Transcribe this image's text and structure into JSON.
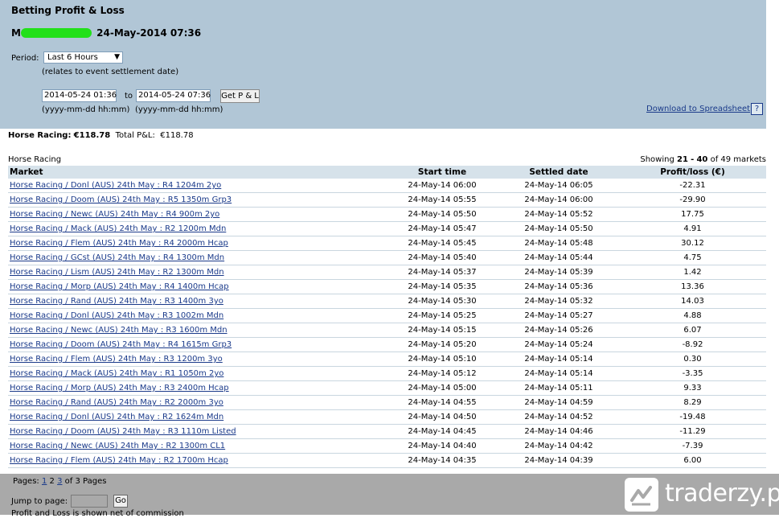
{
  "header": {
    "title": "Betting Profit & Loss",
    "account_initial": "M",
    "timestamp": "24-May-2014 07:36",
    "period_label": "Period:",
    "period_value": "Last 6 Hours",
    "relates_note": "(relates to event settlement date)",
    "from_value": "2014-05-24 01:36",
    "to_label": "to",
    "to_value": "2014-05-24 07:36",
    "get_button": "Get P & L",
    "format_hint_from": "(yyyy-mm-dd hh:mm)",
    "format_hint_to": "(yyyy-mm-dd hh:mm)",
    "download_link": "Download to Spreadsheet",
    "help_icon": "?"
  },
  "summary": {
    "sport_label": "Horse Racing:",
    "sport_value": "€118.78",
    "total_label": "Total P&L:",
    "total_value": "€118.78"
  },
  "section": {
    "label": "Horse Racing",
    "showing_prefix": "Showing",
    "range_from": "21",
    "range_sep": "-",
    "range_to": "40",
    "of_text": "of 49 markets"
  },
  "table": {
    "columns": [
      "Market",
      "Start time",
      "Settled date",
      "Profit/loss (€)"
    ],
    "rows": [
      {
        "market": "Horse Racing / Donl (AUS) 24th May : R4 1204m 2yo",
        "start": "24-May-14 06:00",
        "settled": "24-May-14 06:05",
        "pl": "-22.31"
      },
      {
        "market": "Horse Racing / Doom (AUS) 24th May : R5 1350m Grp3",
        "start": "24-May-14 05:55",
        "settled": "24-May-14 06:00",
        "pl": "-29.90"
      },
      {
        "market": "Horse Racing / Newc (AUS) 24th May : R4 900m 2yo",
        "start": "24-May-14 05:50",
        "settled": "24-May-14 05:52",
        "pl": "17.75"
      },
      {
        "market": "Horse Racing / Mack (AUS) 24th May : R2 1200m Mdn",
        "start": "24-May-14 05:47",
        "settled": "24-May-14 05:50",
        "pl": "4.91"
      },
      {
        "market": "Horse Racing / Flem (AUS) 24th May : R4 2000m Hcap",
        "start": "24-May-14 05:45",
        "settled": "24-May-14 05:48",
        "pl": "30.12"
      },
      {
        "market": "Horse Racing / GCst (AUS) 24th May : R4 1300m Mdn",
        "start": "24-May-14 05:40",
        "settled": "24-May-14 05:44",
        "pl": "4.75"
      },
      {
        "market": "Horse Racing / Lism (AUS) 24th May : R2 1300m Mdn",
        "start": "24-May-14 05:37",
        "settled": "24-May-14 05:39",
        "pl": "1.42"
      },
      {
        "market": "Horse Racing / Morp (AUS) 24th May : R4 1400m Hcap",
        "start": "24-May-14 05:35",
        "settled": "24-May-14 05:36",
        "pl": "13.36"
      },
      {
        "market": "Horse Racing / Rand (AUS) 24th May : R3 1400m 3yo",
        "start": "24-May-14 05:30",
        "settled": "24-May-14 05:32",
        "pl": "14.03"
      },
      {
        "market": "Horse Racing / Donl (AUS) 24th May : R3 1002m Mdn",
        "start": "24-May-14 05:25",
        "settled": "24-May-14 05:27",
        "pl": "4.88"
      },
      {
        "market": "Horse Racing / Newc (AUS) 24th May : R3 1600m Mdn",
        "start": "24-May-14 05:15",
        "settled": "24-May-14 05:26",
        "pl": "6.07"
      },
      {
        "market": "Horse Racing / Doom (AUS) 24th May : R4 1615m Grp3",
        "start": "24-May-14 05:20",
        "settled": "24-May-14 05:24",
        "pl": "-8.92"
      },
      {
        "market": "Horse Racing / Flem (AUS) 24th May : R3 1200m 3yo",
        "start": "24-May-14 05:10",
        "settled": "24-May-14 05:14",
        "pl": "0.30"
      },
      {
        "market": "Horse Racing / Mack (AUS) 24th May : R1 1050m 2yo",
        "start": "24-May-14 05:12",
        "settled": "24-May-14 05:14",
        "pl": "-3.35"
      },
      {
        "market": "Horse Racing / Morp (AUS) 24th May : R3 2400m Hcap",
        "start": "24-May-14 05:00",
        "settled": "24-May-14 05:11",
        "pl": "9.33"
      },
      {
        "market": "Horse Racing / Rand (AUS) 24th May : R2 2000m 3yo",
        "start": "24-May-14 04:55",
        "settled": "24-May-14 04:59",
        "pl": "8.29"
      },
      {
        "market": "Horse Racing / Donl (AUS) 24th May : R2 1624m Mdn",
        "start": "24-May-14 04:50",
        "settled": "24-May-14 04:52",
        "pl": "-19.48"
      },
      {
        "market": "Horse Racing / Doom (AUS) 24th May : R3 1110m Listed",
        "start": "24-May-14 04:45",
        "settled": "24-May-14 04:46",
        "pl": "-11.29"
      },
      {
        "market": "Horse Racing / Newc (AUS) 24th May : R2 1300m CL1",
        "start": "24-May-14 04:40",
        "settled": "24-May-14 04:42",
        "pl": "-7.39"
      },
      {
        "market": "Horse Racing / Flem (AUS) 24th May : R2 1700m Hcap",
        "start": "24-May-14 04:35",
        "settled": "24-May-14 04:39",
        "pl": "6.00"
      }
    ]
  },
  "footer": {
    "pages_label": "Pages:",
    "pages": [
      "1",
      "2",
      "3"
    ],
    "current_page": "2",
    "pages_of": "of 3 Pages",
    "jump_label": "Jump to page:",
    "go_button": "Go",
    "note": "Profit and Loss is shown net of commission"
  },
  "watermark": {
    "brand": "traderzy.pl",
    "icon": "chart-trend-icon"
  },
  "colors": {
    "header_bg": "#b1c6d6",
    "table_header_bg": "#d6e2ea",
    "link": "#1a3a8a",
    "footer_bg": "#a9a9a9",
    "redaction": "#22e01a"
  }
}
